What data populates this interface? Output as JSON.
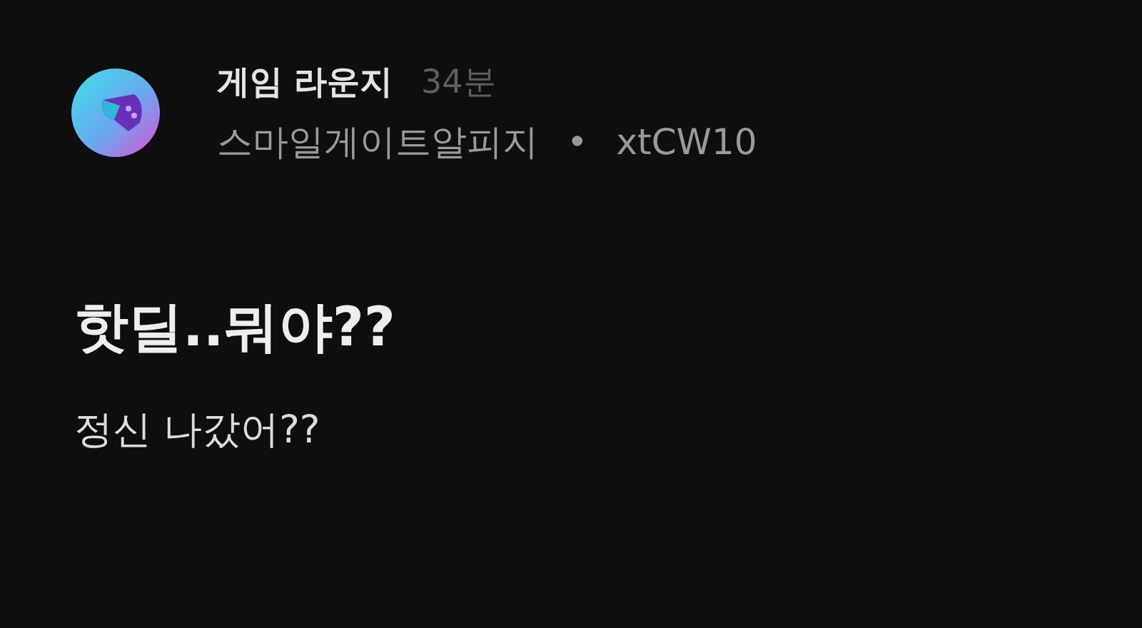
{
  "post": {
    "community": "게임 라운지",
    "time": "34분",
    "board": "스마일게이트알피지",
    "separator": "•",
    "author": "xtCW10",
    "title": "핫딜..뭐야??",
    "body": "정신 나갔어??"
  }
}
